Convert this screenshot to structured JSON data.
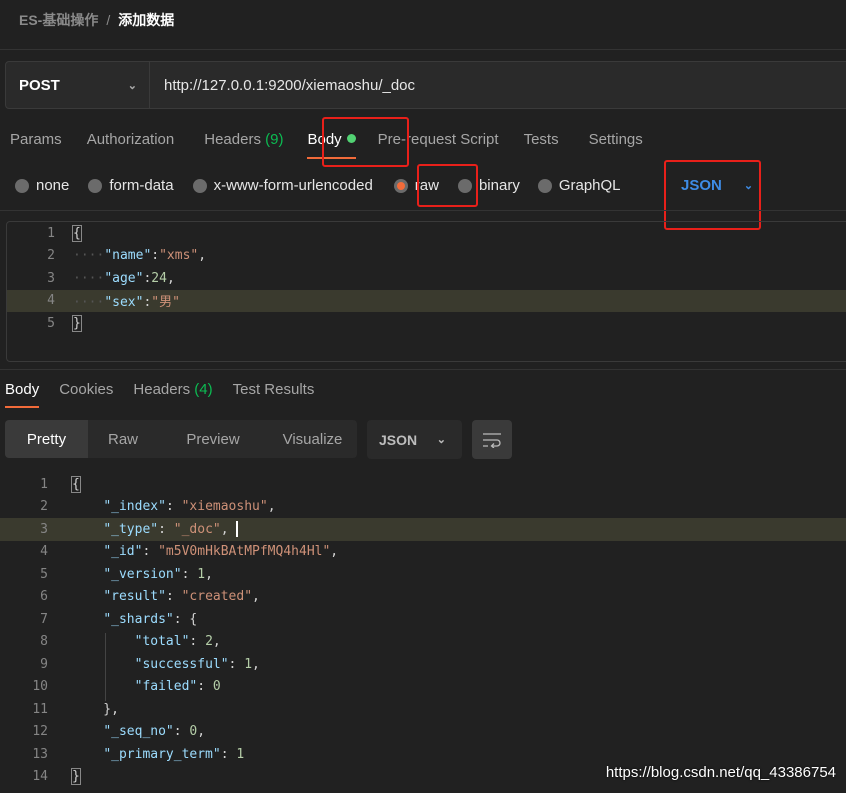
{
  "breadcrumb": {
    "parent": "ES-基础操作",
    "separator": "/",
    "current": "添加数据"
  },
  "request": {
    "method": "POST",
    "url": "http://127.0.0.1:9200/xiemaoshu/_doc"
  },
  "request_tabs": [
    {
      "label": "Params"
    },
    {
      "label": "Authorization"
    },
    {
      "label": "Headers",
      "count": "(9)"
    },
    {
      "label": "Body",
      "active": true
    },
    {
      "label": "Pre-request Script"
    },
    {
      "label": "Tests"
    },
    {
      "label": "Settings"
    }
  ],
  "body_types": [
    {
      "label": "none"
    },
    {
      "label": "form-data"
    },
    {
      "label": "x-www-form-urlencoded"
    },
    {
      "label": "raw",
      "selected": true
    },
    {
      "label": "binary"
    },
    {
      "label": "GraphQL"
    }
  ],
  "body_format": "JSON",
  "request_body": [
    [
      [
        "{",
        "p"
      ]
    ],
    [
      [
        "····",
        "ws"
      ],
      [
        "\"name\"",
        "k"
      ],
      [
        ":",
        "p"
      ],
      [
        "\"xms\"",
        "s"
      ],
      [
        ",",
        "p"
      ]
    ],
    [
      [
        "····",
        "ws"
      ],
      [
        "\"age\"",
        "k"
      ],
      [
        ":",
        "p"
      ],
      [
        "24",
        "n"
      ],
      [
        ",",
        "p"
      ]
    ],
    [
      [
        "····",
        "ws"
      ],
      [
        "\"sex\"",
        "k"
      ],
      [
        ":",
        "p"
      ],
      [
        "\"男\"",
        "s"
      ]
    ],
    [
      [
        "}",
        "p"
      ]
    ]
  ],
  "response_tabs": [
    {
      "label": "Body",
      "active": true
    },
    {
      "label": "Cookies"
    },
    {
      "label": "Headers",
      "count": "(4)"
    },
    {
      "label": "Test Results"
    }
  ],
  "view_modes": [
    "Pretty",
    "Raw",
    "Preview",
    "Visualize"
  ],
  "response_format": "JSON",
  "response_body": [
    [
      [
        "{",
        "p"
      ]
    ],
    [
      [
        "    ",
        "p"
      ],
      [
        "\"_index\"",
        "k"
      ],
      [
        ": ",
        "p"
      ],
      [
        "\"xiemaoshu\"",
        "s"
      ],
      [
        ",",
        "p"
      ]
    ],
    [
      [
        "    ",
        "p"
      ],
      [
        "\"_type\"",
        "k"
      ],
      [
        ": ",
        "p"
      ],
      [
        "\"_doc\"",
        "s"
      ],
      [
        ",",
        "p"
      ]
    ],
    [
      [
        "    ",
        "p"
      ],
      [
        "\"_id\"",
        "k"
      ],
      [
        ": ",
        "p"
      ],
      [
        "\"m5V0mHkBAtMPfMQ4h4Hl\"",
        "s"
      ],
      [
        ",",
        "p"
      ]
    ],
    [
      [
        "    ",
        "p"
      ],
      [
        "\"_version\"",
        "k"
      ],
      [
        ": ",
        "p"
      ],
      [
        "1",
        "n"
      ],
      [
        ",",
        "p"
      ]
    ],
    [
      [
        "    ",
        "p"
      ],
      [
        "\"result\"",
        "k"
      ],
      [
        ": ",
        "p"
      ],
      [
        "\"created\"",
        "s"
      ],
      [
        ",",
        "p"
      ]
    ],
    [
      [
        "    ",
        "p"
      ],
      [
        "\"_shards\"",
        "k"
      ],
      [
        ": {",
        "p"
      ]
    ],
    [
      [
        "        ",
        "p"
      ],
      [
        "\"total\"",
        "k"
      ],
      [
        ": ",
        "p"
      ],
      [
        "2",
        "n"
      ],
      [
        ",",
        "p"
      ]
    ],
    [
      [
        "        ",
        "p"
      ],
      [
        "\"successful\"",
        "k"
      ],
      [
        ": ",
        "p"
      ],
      [
        "1",
        "n"
      ],
      [
        ",",
        "p"
      ]
    ],
    [
      [
        "        ",
        "p"
      ],
      [
        "\"failed\"",
        "k"
      ],
      [
        ": ",
        "p"
      ],
      [
        "0",
        "n"
      ]
    ],
    [
      [
        "    },",
        "p"
      ]
    ],
    [
      [
        "    ",
        "p"
      ],
      [
        "\"_seq_no\"",
        "k"
      ],
      [
        ": ",
        "p"
      ],
      [
        "0",
        "n"
      ],
      [
        ",",
        "p"
      ]
    ],
    [
      [
        "    ",
        "p"
      ],
      [
        "\"_primary_term\"",
        "k"
      ],
      [
        ": ",
        "p"
      ],
      [
        "1",
        "n"
      ]
    ],
    [
      [
        "}",
        "p"
      ]
    ]
  ],
  "watermark": "https://blog.csdn.net/qq_43386754",
  "colors": {
    "accent": "#f26b3a",
    "highlight_box": "#e8201a",
    "json_blue": "#3e8ce6",
    "count_green": "#0cbb52"
  }
}
